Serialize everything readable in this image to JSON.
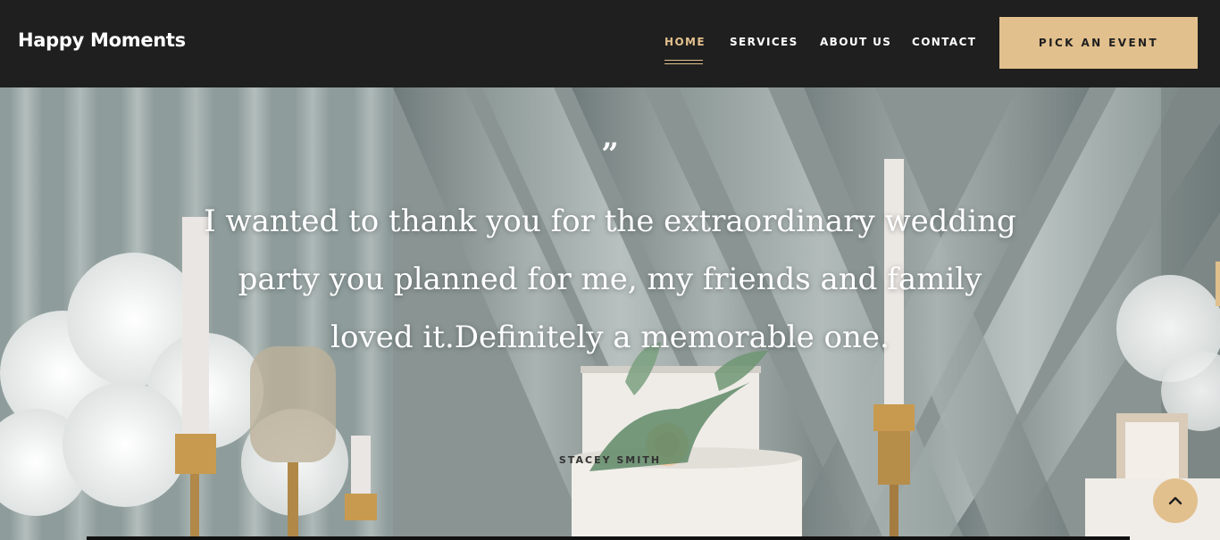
{
  "brand": {
    "name": "Happy Moments"
  },
  "nav": {
    "items": [
      {
        "label": "HOME",
        "active": true
      },
      {
        "label": "SERVICES",
        "active": false
      },
      {
        "label": "ABOUT US",
        "active": false
      },
      {
        "label": "CONTACT",
        "active": false
      }
    ],
    "cta_label": "PICK AN EVENT"
  },
  "testimonial": {
    "quote_mark": "”",
    "text": "I wanted to thank you for the extraordinary wedding party you planned for me, my friends and family loved it.Definitely a memorable one.",
    "author": "STACEY SMITH"
  },
  "colors": {
    "accent": "#e2c08d",
    "header_bg": "#1f1f1f",
    "text_light": "#ffffff"
  },
  "icons": {
    "scroll_top": "chevron-up-icon"
  }
}
